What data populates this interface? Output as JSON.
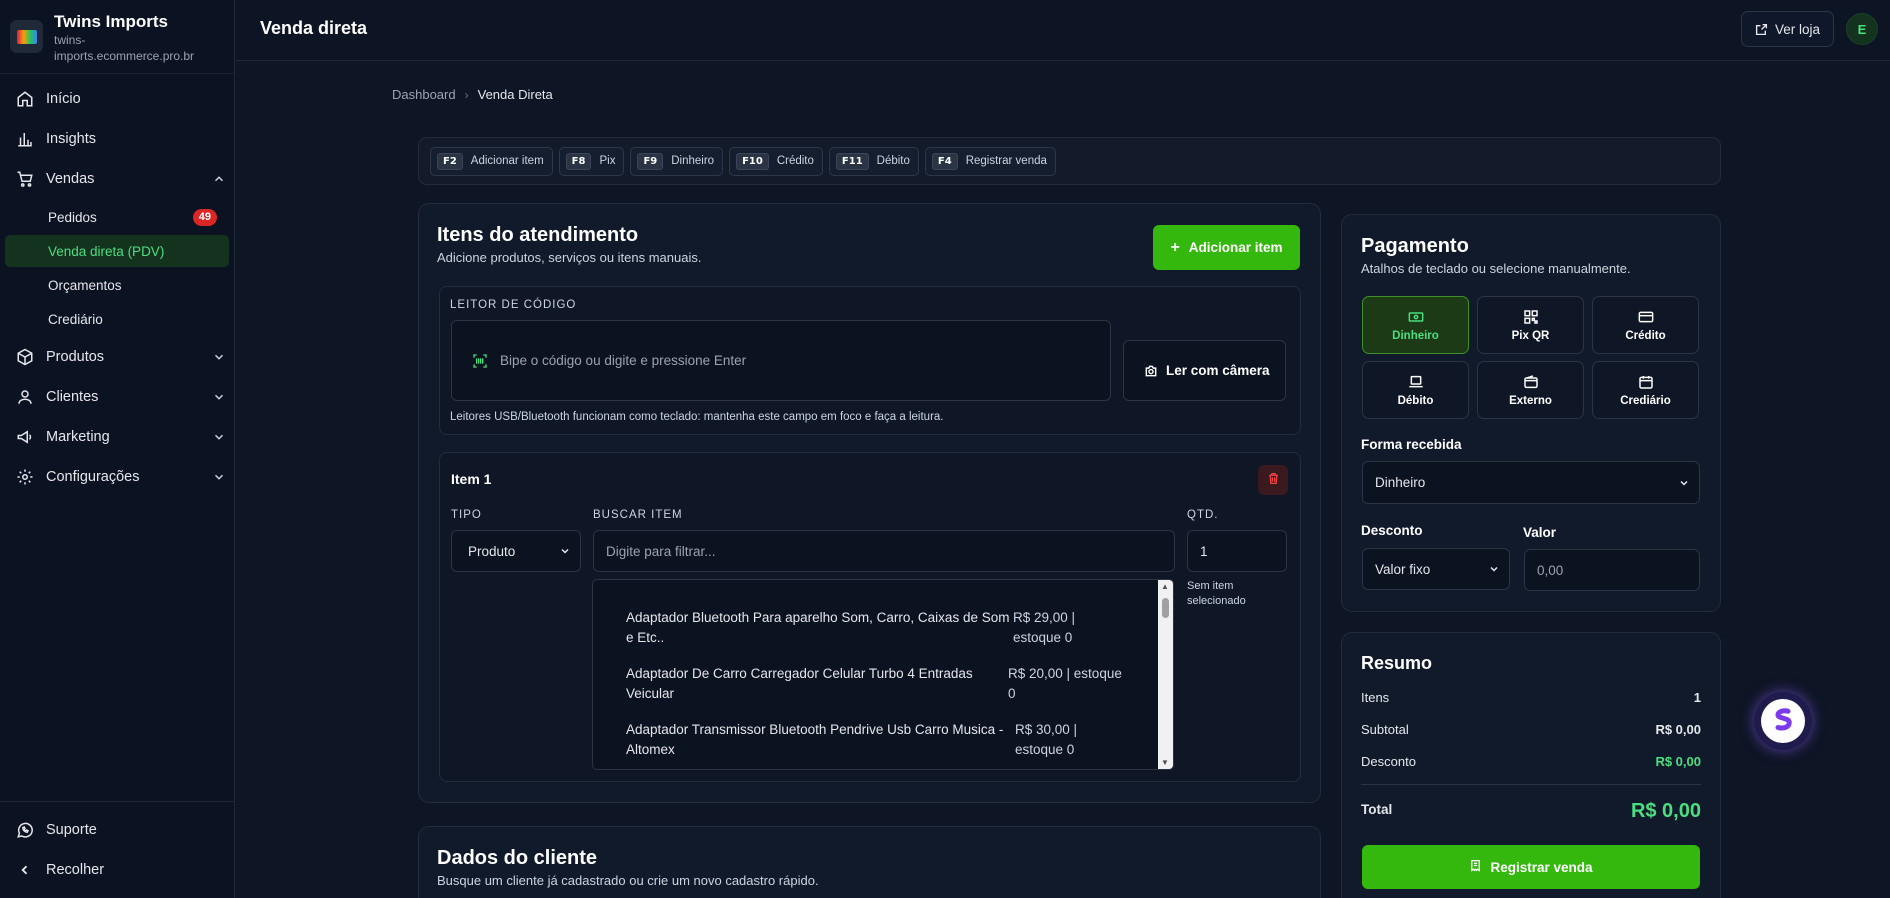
{
  "brand": {
    "name": "Twins Imports",
    "domain": "twins-imports.ecommerce.pro.br"
  },
  "sidebar": {
    "inicio": "Início",
    "insights": "Insights",
    "vendas": "Vendas",
    "pedidos": "Pedidos",
    "pedidos_badge": "49",
    "venda_direta": "Venda direta (PDV)",
    "orcamentos": "Orçamentos",
    "crediario": "Crediário",
    "produtos": "Produtos",
    "clientes": "Clientes",
    "marketing": "Marketing",
    "configuracoes": "Configurações",
    "suporte": "Suporte",
    "recolher": "Recolher"
  },
  "header": {
    "title": "Venda direta",
    "ver_loja": "Ver loja",
    "avatar_initial": "E"
  },
  "breadcrumb": {
    "root": "Dashboard",
    "current": "Venda Direta"
  },
  "shortcuts": [
    {
      "key": "F2",
      "label": "Adicionar item"
    },
    {
      "key": "F8",
      "label": "Pix"
    },
    {
      "key": "F9",
      "label": "Dinheiro"
    },
    {
      "key": "F10",
      "label": "Crédito"
    },
    {
      "key": "F11",
      "label": "Débito"
    },
    {
      "key": "F4",
      "label": "Registrar venda"
    }
  ],
  "items_card": {
    "title": "Itens do atendimento",
    "subtitle": "Adicione produtos, serviços ou itens manuais.",
    "add_button": "Adicionar item",
    "scanner_label": "LEITOR DE CÓDIGO",
    "scanner_placeholder": "Bipe o código ou digite e pressione Enter",
    "camera_button": "Ler com câmera",
    "scanner_hint": "Leitores USB/Bluetooth funcionam como teclado: mantenha este campo em foco e faça a leitura.",
    "item_title": "Item 1",
    "tipo_label": "TIPO",
    "tipo_value": "Produto",
    "buscar_label": "BUSCAR ITEM",
    "buscar_placeholder": "Digite para filtrar...",
    "qtd_label": "QTD.",
    "qtd_value": "1",
    "no_item": "Sem item selecionado",
    "results": [
      {
        "name": "Adaptador Bluetooth Para aparelho Som, Carro, Caixas de Som e Etc..",
        "price": "R$ 29,00 | estoque 0"
      },
      {
        "name": "Adaptador De Carro Carregador Celular Turbo 4 Entradas Veicular",
        "price": "R$ 20,00 | estoque 0"
      },
      {
        "name": "Adaptador Transmissor Bluetooth Pendrive Usb Carro Musica - Altomex",
        "price": "R$ 30,00 | estoque 0"
      }
    ]
  },
  "cliente_card": {
    "title": "Dados do cliente",
    "subtitle": "Busque um cliente já cadastrado ou crie um novo cadastro rápido."
  },
  "payment": {
    "title": "Pagamento",
    "subtitle": "Atalhos de teclado ou selecione manualmente.",
    "methods": [
      "Dinheiro",
      "Pix QR",
      "Crédito",
      "Débito",
      "Externo",
      "Crediário"
    ],
    "forma_label": "Forma recebida",
    "forma_value": "Dinheiro",
    "desconto_label": "Desconto",
    "desconto_value": "Valor fixo",
    "valor_label": "Valor",
    "valor_placeholder": "0,00"
  },
  "summary": {
    "title": "Resumo",
    "itens_label": "Itens",
    "itens_value": "1",
    "subtotal_label": "Subtotal",
    "subtotal_value": "R$ 0,00",
    "desconto_label": "Desconto",
    "desconto_value": "R$ 0,00",
    "total_label": "Total",
    "total_value": "R$ 0,00",
    "register_button": "Registrar venda"
  },
  "colors": {
    "accent": "#34b80e",
    "accent_text": "#4ade80",
    "background": "#0e1525",
    "badge": "#dc2626"
  }
}
